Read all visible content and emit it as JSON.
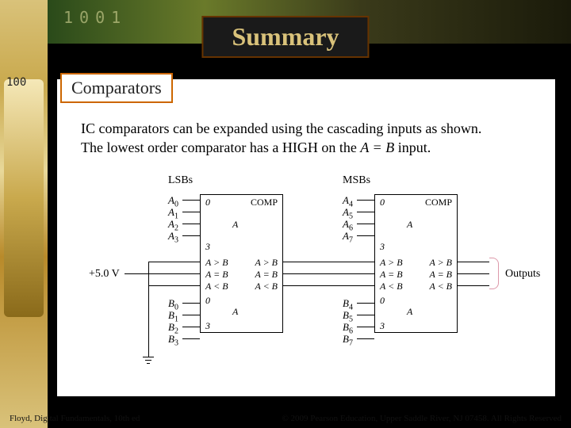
{
  "title": "Summary",
  "top_digits": "1001",
  "side_label": "100",
  "section": "Comparators",
  "body_line1": "IC comparators can be expanded using the cascading inputs as shown.",
  "body_line2a": "The lowest order comparator has a HIGH on the ",
  "body_line2_ital": "A = B",
  "body_line2b": " input.",
  "labels": {
    "lsbs": "LSBs",
    "msbs": "MSBs",
    "comp": "COMP",
    "A": "A",
    "zero": "0",
    "three": "3",
    "agtb": "A > B",
    "aeqb": "A = B",
    "altb": "A < B",
    "outputs": "Outputs",
    "v5": "+5.0 V"
  },
  "pins_left_A": [
    "A0",
    "A1",
    "A2",
    "A3"
  ],
  "pins_left_B": [
    "B0",
    "B1",
    "B2",
    "B3"
  ],
  "pins_right_A": [
    "A4",
    "A5",
    "A6",
    "A7"
  ],
  "pins_right_B": [
    "B4",
    "B5",
    "B6",
    "B7"
  ],
  "footer_left": "Floyd, Digital Fundamentals, 10th ed",
  "footer_right": "© 2009 Pearson Education, Upper Saddle River, NJ 07458. All Rights Reserved"
}
